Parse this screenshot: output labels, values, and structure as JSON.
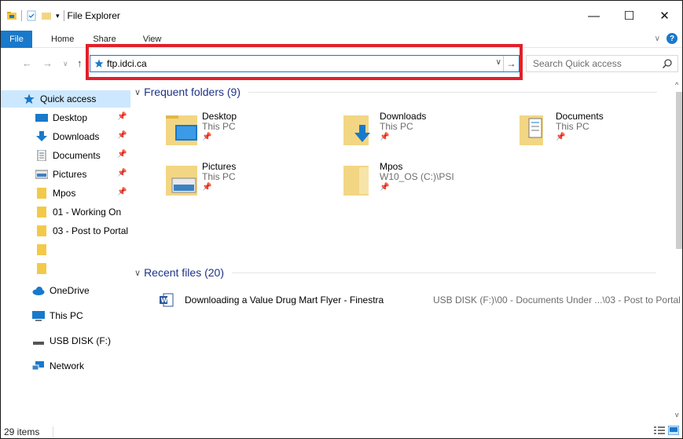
{
  "window": {
    "title": "File Explorer"
  },
  "window_controls": {
    "minimize": "—",
    "maximize": "☐",
    "close": "✕"
  },
  "ribbon": {
    "file_tab": "File",
    "tabs": [
      "Home",
      "Share",
      "View"
    ]
  },
  "address_bar": {
    "value": "ftp.idci.ca"
  },
  "search": {
    "placeholder": "Search Quick access"
  },
  "sidebar": {
    "items": [
      {
        "label": "Quick access",
        "icon": "star-icon",
        "pinned": false,
        "selected": true
      },
      {
        "label": "Desktop",
        "icon": "desktop-icon",
        "pinned": true
      },
      {
        "label": "Downloads",
        "icon": "download-icon",
        "pinned": true
      },
      {
        "label": "Documents",
        "icon": "documents-icon",
        "pinned": true
      },
      {
        "label": "Pictures",
        "icon": "pictures-icon",
        "pinned": true
      },
      {
        "label": "Mpos",
        "icon": "folder-icon",
        "pinned": true
      },
      {
        "label": "01 - Working On",
        "icon": "folder-icon",
        "pinned": false
      },
      {
        "label": "03 - Post to Portal",
        "icon": "folder-icon",
        "pinned": false
      },
      {
        "label": "",
        "icon": "folder-icon",
        "pinned": false
      },
      {
        "label": "",
        "icon": "folder-icon",
        "pinned": false
      },
      {
        "label": "OneDrive",
        "icon": "cloud-icon",
        "pinned": false
      },
      {
        "label": "This PC",
        "icon": "computer-icon",
        "pinned": false
      },
      {
        "label": "USB DISK (F:)",
        "icon": "drive-icon",
        "pinned": false
      },
      {
        "label": "Network",
        "icon": "network-icon",
        "pinned": false
      }
    ]
  },
  "frequent": {
    "header": "Frequent folders (9)",
    "folders": [
      {
        "name": "Desktop",
        "location": "This PC",
        "icon": "desktop-folder-icon"
      },
      {
        "name": "Downloads",
        "location": "This PC",
        "icon": "downloads-folder-icon"
      },
      {
        "name": "Documents",
        "location": "This PC",
        "icon": "documents-folder-icon"
      },
      {
        "name": "Pictures",
        "location": "This PC",
        "icon": "pictures-folder-icon"
      },
      {
        "name": "Mpos",
        "location": "W10_OS (C:)\\PSI",
        "icon": "folder-icon"
      }
    ]
  },
  "recent": {
    "header": "Recent files (20)",
    "files": [
      {
        "name": "Downloading a Value Drug Mart Flyer - Finestra",
        "path": "USB DISK (F:)\\00 - Documents Under ...\\03 - Post to Portal",
        "icon": "word-doc-icon"
      }
    ]
  },
  "status": {
    "item_count": "29 items"
  },
  "colors": {
    "accent": "#1979ca",
    "selection": "#cce8ff",
    "highlight_box": "#e0202a",
    "section_header": "#1e3287"
  }
}
